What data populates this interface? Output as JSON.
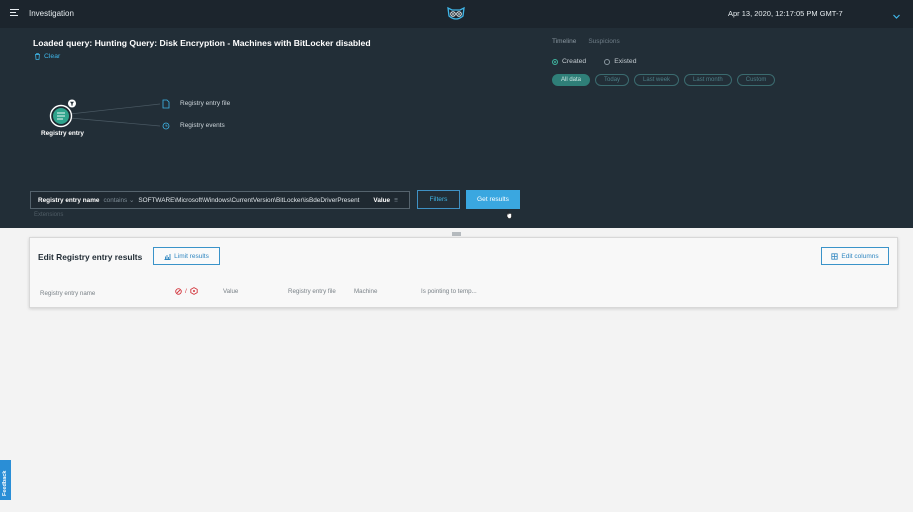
{
  "header": {
    "app_title": "Investigation",
    "datetime": "Apr 13, 2020, 12:17:05 PM GMT-7",
    "menu_icon": "hamburger-icon",
    "logo_icon": "owl-logo-icon",
    "expand_icon": "chevron-down-icon"
  },
  "query": {
    "title": "Loaded query: Hunting Query: Disk Encryption - Machines with BitLocker disabled",
    "clear_label": "Clear"
  },
  "timeline": {
    "tabs": [
      "Timeline",
      "Suspicions"
    ],
    "active_tab": "Timeline",
    "radios": [
      {
        "label": "Created",
        "selected": true
      },
      {
        "label": "Existed",
        "selected": false
      }
    ],
    "ranges": [
      "All data",
      "Today",
      "Last week",
      "Last month",
      "Custom"
    ],
    "selected_range": "All data"
  },
  "graph": {
    "main_node": "Registry entry",
    "linked_nodes": [
      "Registry entry file",
      "Registry events"
    ]
  },
  "filter_bar": {
    "field": "Registry entry name",
    "operator": "contains ⌄",
    "value": "SOFTWARE\\Microsoft\\Windows\\CurrentVersion\\BitLocker\\isBdeDriverPresent",
    "value_label": "Value",
    "value_suffix": "≡",
    "subtext": "Extensions",
    "filters_label": "Filters",
    "get_results_label": "Get results"
  },
  "results": {
    "title": "Edit Registry entry results",
    "limit_label": "Limit results",
    "edit_columns_label": "Edit columns",
    "columns": [
      "Registry entry name",
      "Value",
      "Registry entry file",
      "Machine",
      "Is pointing to temp..."
    ],
    "severity_separator": "/"
  },
  "feedback_label": "Feedback",
  "colors": {
    "accent": "#3aa7e0",
    "teal": "#2f7f78",
    "dark_bg": "#222e37",
    "alert_red": "#d3363d"
  }
}
